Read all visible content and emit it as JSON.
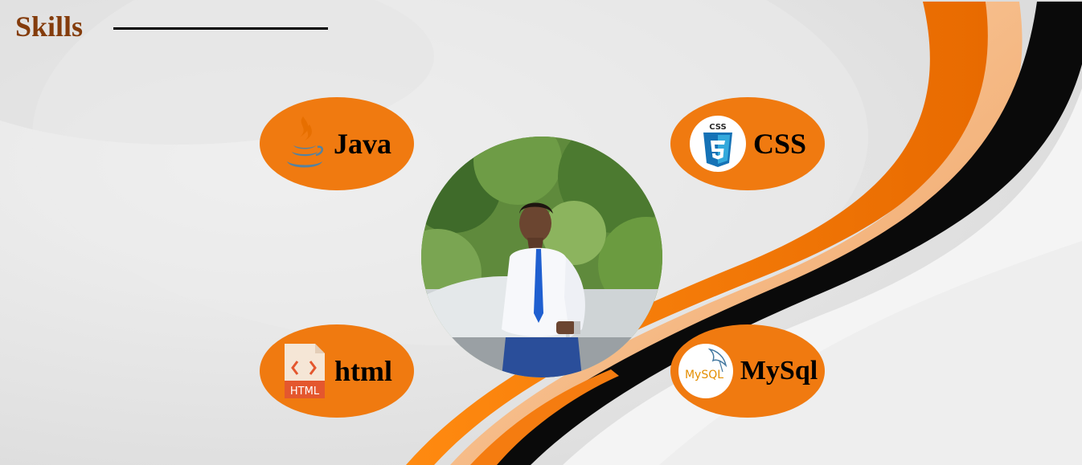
{
  "slide": {
    "title": "Skills",
    "colors": {
      "title": "#843c0c",
      "pill": "#f07a10",
      "swoosh_orange": "#f57c10",
      "swoosh_black": "#000000"
    }
  },
  "skills": [
    {
      "label": "Java",
      "icon": "java-icon"
    },
    {
      "label": "CSS",
      "icon": "css3-icon"
    },
    {
      "label": "html",
      "icon": "html-file-icon",
      "icon_text": "HTML"
    },
    {
      "label": "MySql",
      "icon": "mysql-logo-icon",
      "icon_text": "MySQL"
    }
  ],
  "photo": {
    "icon": "profile-photo"
  },
  "css_badge_text": "CSS"
}
